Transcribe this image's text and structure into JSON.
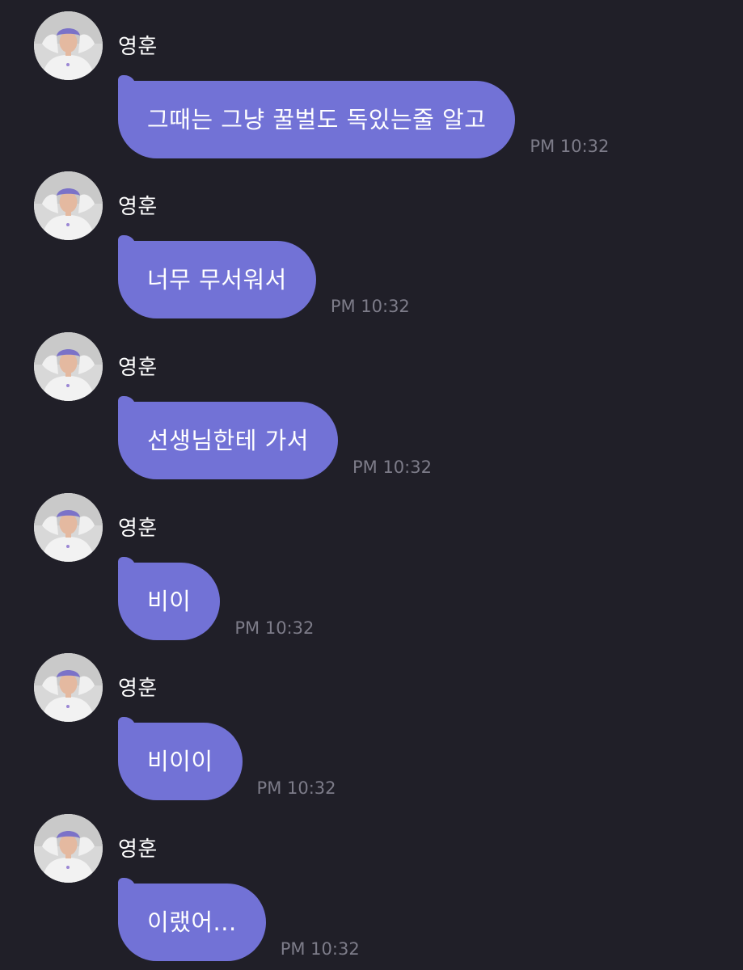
{
  "conversation": {
    "messages": [
      {
        "sender": "영훈",
        "text": "그때는 그냥 꿀벌도 독있는줄 알고",
        "time": "PM 10:32"
      },
      {
        "sender": "영훈",
        "text": "너무 무서워서",
        "time": "PM 10:32"
      },
      {
        "sender": "영훈",
        "text": "선생님한테 가서",
        "time": "PM 10:32"
      },
      {
        "sender": "영훈",
        "text": "비이",
        "time": "PM 10:32"
      },
      {
        "sender": "영훈",
        "text": "비이이",
        "time": "PM 10:32"
      },
      {
        "sender": "영훈",
        "text": "이랬어...",
        "time": "PM 10:32"
      }
    ]
  },
  "colors": {
    "background": "#201f28",
    "bubble": "#7272d6",
    "timestamp": "#7d7c89",
    "sender_name": "#ffffff"
  },
  "icons": {
    "avatar": "profile-photo-avatar"
  }
}
